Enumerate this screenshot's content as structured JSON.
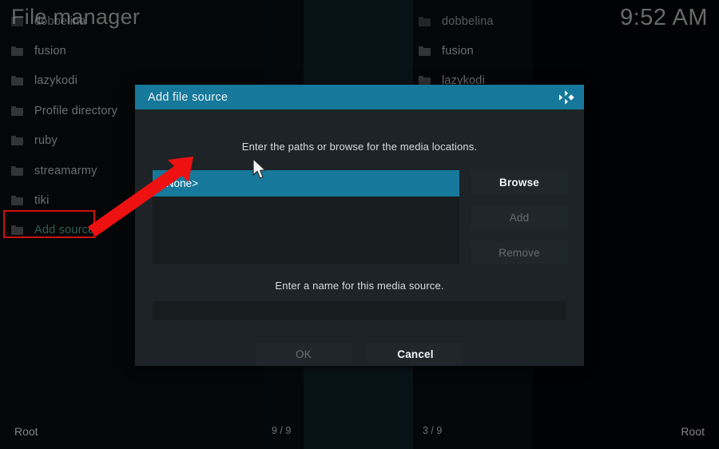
{
  "header": {
    "title": "File manager",
    "clock": "9:52 AM"
  },
  "colors": {
    "accent_teal": "#16789a",
    "annotation_red": "#cc1111",
    "dialog_bg": "#1d2326",
    "window_bg": "#030405"
  },
  "left_panel": {
    "items": [
      {
        "label": "dobbelina",
        "state": "dim"
      },
      {
        "label": "fusion",
        "state": "normal"
      },
      {
        "label": "lazykodi",
        "state": "normal"
      },
      {
        "label": "Profile directory",
        "state": "normal"
      },
      {
        "label": "ruby",
        "state": "normal"
      },
      {
        "label": "streamarmy",
        "state": "normal"
      },
      {
        "label": "tiki",
        "state": "normal"
      },
      {
        "label": "Add source",
        "state": "accent"
      }
    ],
    "icon": "folder-icon"
  },
  "right_panel": {
    "items": [
      {
        "label": "dobbelina",
        "state": "dim"
      },
      {
        "label": "fusion",
        "state": "normal"
      },
      {
        "label": "lazykodi",
        "state": "normal"
      }
    ],
    "icon": "folder-icon"
  },
  "dialog": {
    "title": "Add file source",
    "logo_icon": "kodi-logo-icon",
    "hint_paths": "Enter the paths or browse for the media locations.",
    "hint_name": "Enter a name for this media source.",
    "source_list": [
      {
        "label": "<None>",
        "selected": true
      }
    ],
    "buttons": {
      "browse": "Browse",
      "add": "Add",
      "remove": "Remove",
      "ok": "OK",
      "cancel": "Cancel"
    },
    "name_input": {
      "value": "",
      "placeholder": ""
    }
  },
  "statusbar": {
    "left_path": "Root",
    "left_count": "9 / 9",
    "right_count": "3 / 9",
    "right_path": "Root"
  },
  "annotations": {
    "arrow_icon": "red-arrow-icon",
    "highlight_box_target": "Add source",
    "cursor_icon": "mouse-pointer-icon"
  }
}
